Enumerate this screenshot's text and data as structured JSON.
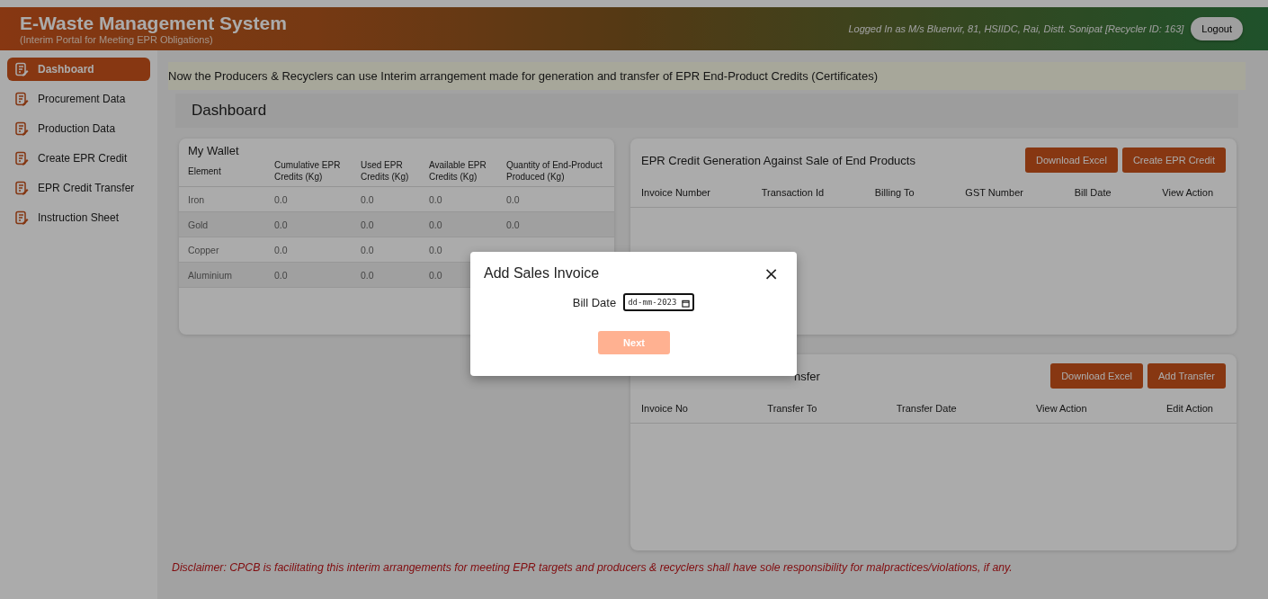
{
  "header": {
    "title": "E-Waste Management System",
    "subtitle": "(Interim Portal for Meeting EPR Obligations)",
    "user_info": "Logged In as M/s Bluenvir, 81, HSIIDC, Rai, Distt. Sonipat [Recycler ID: 163]",
    "logout": "Logout"
  },
  "sidebar": {
    "items": [
      {
        "label": "Dashboard",
        "selected": true
      },
      {
        "label": "Procurement Data",
        "selected": false
      },
      {
        "label": "Production Data",
        "selected": false
      },
      {
        "label": "Create EPR Credit",
        "selected": false
      },
      {
        "label": "EPR Credit Transfer",
        "selected": false
      },
      {
        "label": "Instruction Sheet",
        "selected": false
      }
    ]
  },
  "notice": "Now the Producers & Recyclers can use Interim arrangement made for generation and transfer of EPR End-Product Credits (Certificates)",
  "page_title": "Dashboard",
  "wallet": {
    "title": "My Wallet",
    "columns": [
      "Element",
      "Cumulative EPR Credits (Kg)",
      "Used EPR Credits (Kg)",
      "Available EPR Credits (Kg)",
      "Quantity of End-Product Produced (Kg)"
    ],
    "rows": [
      [
        "Iron",
        "0.0",
        "0.0",
        "0.0",
        "0.0"
      ],
      [
        "Gold",
        "0.0",
        "0.0",
        "0.0",
        "0.0"
      ],
      [
        "Copper",
        "0.0",
        "0.0",
        "0.0"
      ],
      [
        "Aluminium",
        "0.0",
        "0.0",
        "0.0"
      ]
    ]
  },
  "credit_generation": {
    "title": "EPR Credit Generation Against Sale of End Products",
    "buttons": [
      "Download Excel",
      "Create EPR Credit"
    ],
    "columns": [
      "Invoice Number",
      "Transaction Id",
      "Billing To",
      "GST Number",
      "Bill Date",
      "View Action"
    ]
  },
  "transfer": {
    "title": "nsfer",
    "buttons": [
      "Download Excel",
      "Add Transfer"
    ],
    "columns": [
      "Invoice No",
      "Transfer To",
      "Transfer Date",
      "View Action",
      "Edit Action"
    ]
  },
  "disclaimer": "Disclaimer: CPCB is facilitating this interim arrangements for meeting EPR targets and producers & recyclers shall have sole responsibility for malpractices/violations, if any.",
  "modal": {
    "title": "Add Sales Invoice",
    "close": "×",
    "field_label": "Bill Date",
    "field_value": "dd-mm-2023",
    "button": "Next",
    "button_disabled": true
  }
}
